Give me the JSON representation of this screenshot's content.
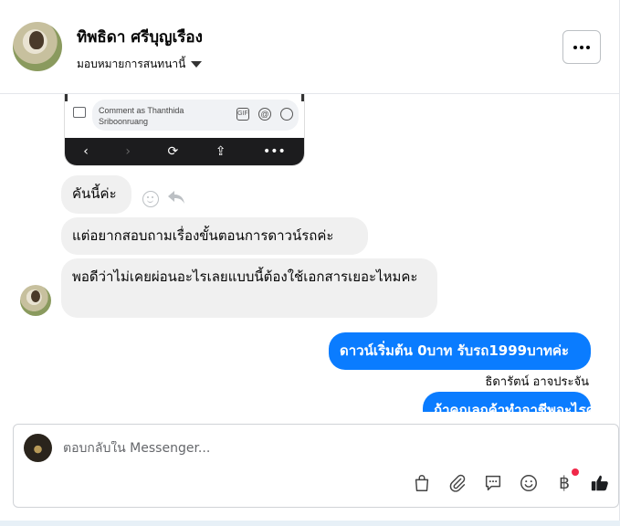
{
  "header": {
    "contact_name": "ทิพธิดา ศรีบุญเรือง",
    "assign_label": "มอบหมายการสนทนานี้"
  },
  "screenshot_preview": {
    "comment_placeholder": "Comment as Thanthida Sriboonruang",
    "gif_label": "GIF",
    "at_label": "@",
    "nav_back": "‹",
    "nav_forward": "›",
    "nav_refresh": "⟳",
    "nav_share": "⇪",
    "nav_more": "•••"
  },
  "messages": {
    "incoming": [
      "คันนี้ค่ะ",
      "แต่อยากสอบถามเรื่องขั้นตอนการดาวน์รถค่ะ",
      "พอดีว่าไม่เคยผ่อนอะไรเลยแบบนี้ต้องใช้เอกสารเยอะไหมคะ"
    ],
    "outgoing": [
      "ดาวน์เริ่มต้น 0บาท รับรถ1999บาทค่ะ",
      "ถ้าคุณลูกค้าทำอาชีพอะไรคะ"
    ],
    "sender_name": "ธิดารัตน์ อาจประจัน"
  },
  "composer": {
    "placeholder": "ตอบกลับใน Messenger...",
    "baht_symbol": "฿"
  },
  "icons": {
    "more": "more-icon",
    "caret": "chevron-down-icon",
    "react": "smiley-icon",
    "reply": "reply-arrow-icon",
    "bag": "shopping-bag-icon",
    "attach": "paperclip-icon",
    "saved_reply": "chat-bubble-icon",
    "emoji": "emoji-icon",
    "payment": "baht-icon",
    "like": "thumbs-up-icon"
  },
  "colors": {
    "outgoing_bubble": "#0a7cff",
    "incoming_bubble": "#f0f0f0",
    "notification": "#f02849"
  }
}
